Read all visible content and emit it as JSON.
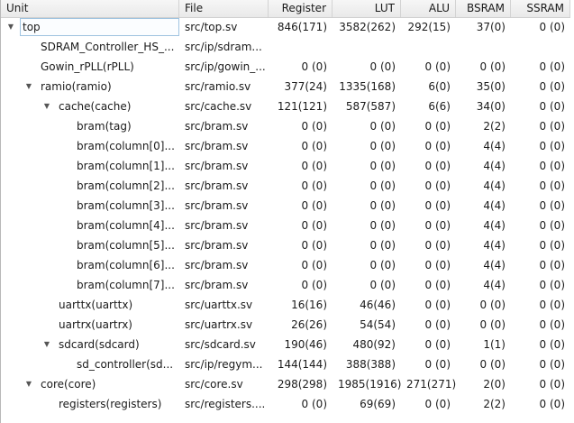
{
  "columns": [
    "Unit",
    "File",
    "Register",
    "LUT",
    "ALU",
    "BSRAM",
    "SSRAM"
  ],
  "rows": [
    {
      "unit": "top",
      "level": 0,
      "expanded": true,
      "selected": true,
      "file": "src/top.sv",
      "register": "846(171)",
      "lut": "3582(262)",
      "alu": "292(15)",
      "bsram": "37(0)",
      "ssram": "0 (0)"
    },
    {
      "unit": "SDRAM_Controller_HS_...",
      "level": 1,
      "file": "src/ip/sdram...",
      "register": "",
      "lut": "",
      "alu": "",
      "bsram": "",
      "ssram": ""
    },
    {
      "unit": "Gowin_rPLL(rPLL)",
      "level": 1,
      "file": "src/ip/gowin_...",
      "register": "0 (0)",
      "lut": "0 (0)",
      "alu": "0 (0)",
      "bsram": "0 (0)",
      "ssram": "0 (0)"
    },
    {
      "unit": "ramio(ramio)",
      "level": 1,
      "expanded": true,
      "file": "src/ramio.sv",
      "register": "377(24)",
      "lut": "1335(168)",
      "alu": "6(0)",
      "bsram": "35(0)",
      "ssram": "0 (0)"
    },
    {
      "unit": "cache(cache)",
      "level": 2,
      "expanded": true,
      "file": "src/cache.sv",
      "register": "121(121)",
      "lut": "587(587)",
      "alu": "6(6)",
      "bsram": "34(0)",
      "ssram": "0 (0)"
    },
    {
      "unit": "bram(tag)",
      "level": 3,
      "file": "src/bram.sv",
      "register": "0 (0)",
      "lut": "0 (0)",
      "alu": "0 (0)",
      "bsram": "2(2)",
      "ssram": "0 (0)"
    },
    {
      "unit": "bram(column[0]...",
      "level": 3,
      "file": "src/bram.sv",
      "register": "0 (0)",
      "lut": "0 (0)",
      "alu": "0 (0)",
      "bsram": "4(4)",
      "ssram": "0 (0)"
    },
    {
      "unit": "bram(column[1]...",
      "level": 3,
      "file": "src/bram.sv",
      "register": "0 (0)",
      "lut": "0 (0)",
      "alu": "0 (0)",
      "bsram": "4(4)",
      "ssram": "0 (0)"
    },
    {
      "unit": "bram(column[2]...",
      "level": 3,
      "file": "src/bram.sv",
      "register": "0 (0)",
      "lut": "0 (0)",
      "alu": "0 (0)",
      "bsram": "4(4)",
      "ssram": "0 (0)"
    },
    {
      "unit": "bram(column[3]...",
      "level": 3,
      "file": "src/bram.sv",
      "register": "0 (0)",
      "lut": "0 (0)",
      "alu": "0 (0)",
      "bsram": "4(4)",
      "ssram": "0 (0)"
    },
    {
      "unit": "bram(column[4]...",
      "level": 3,
      "file": "src/bram.sv",
      "register": "0 (0)",
      "lut": "0 (0)",
      "alu": "0 (0)",
      "bsram": "4(4)",
      "ssram": "0 (0)"
    },
    {
      "unit": "bram(column[5]...",
      "level": 3,
      "file": "src/bram.sv",
      "register": "0 (0)",
      "lut": "0 (0)",
      "alu": "0 (0)",
      "bsram": "4(4)",
      "ssram": "0 (0)"
    },
    {
      "unit": "bram(column[6]...",
      "level": 3,
      "file": "src/bram.sv",
      "register": "0 (0)",
      "lut": "0 (0)",
      "alu": "0 (0)",
      "bsram": "4(4)",
      "ssram": "0 (0)"
    },
    {
      "unit": "bram(column[7]...",
      "level": 3,
      "file": "src/bram.sv",
      "register": "0 (0)",
      "lut": "0 (0)",
      "alu": "0 (0)",
      "bsram": "4(4)",
      "ssram": "0 (0)"
    },
    {
      "unit": "uarttx(uarttx)",
      "level": 2,
      "file": "src/uarttx.sv",
      "register": "16(16)",
      "lut": "46(46)",
      "alu": "0 (0)",
      "bsram": "0 (0)",
      "ssram": "0 (0)"
    },
    {
      "unit": "uartrx(uartrx)",
      "level": 2,
      "file": "src/uartrx.sv",
      "register": "26(26)",
      "lut": "54(54)",
      "alu": "0 (0)",
      "bsram": "0 (0)",
      "ssram": "0 (0)"
    },
    {
      "unit": "sdcard(sdcard)",
      "level": 2,
      "expanded": true,
      "file": "src/sdcard.sv",
      "register": "190(46)",
      "lut": "480(92)",
      "alu": "0 (0)",
      "bsram": "1(1)",
      "ssram": "0 (0)"
    },
    {
      "unit": "sd_controller(sd...",
      "level": 3,
      "file": "src/ip/regym...",
      "register": "144(144)",
      "lut": "388(388)",
      "alu": "0 (0)",
      "bsram": "0 (0)",
      "ssram": "0 (0)"
    },
    {
      "unit": "core(core)",
      "level": 1,
      "expanded": true,
      "file": "src/core.sv",
      "register": "298(298)",
      "lut": "1985(1916)",
      "alu": "271(271)",
      "bsram": "2(0)",
      "ssram": "0 (0)"
    },
    {
      "unit": "registers(registers)",
      "level": 2,
      "file": "src/registers....",
      "register": "0 (0)",
      "lut": "69(69)",
      "alu": "0 (0)",
      "bsram": "2(2)",
      "ssram": "0 (0)"
    }
  ],
  "icons": {
    "expanded": "triangle-down-icon"
  },
  "colors": {
    "selection_border": "#9fc3e0",
    "header_bg": "#ececec"
  }
}
